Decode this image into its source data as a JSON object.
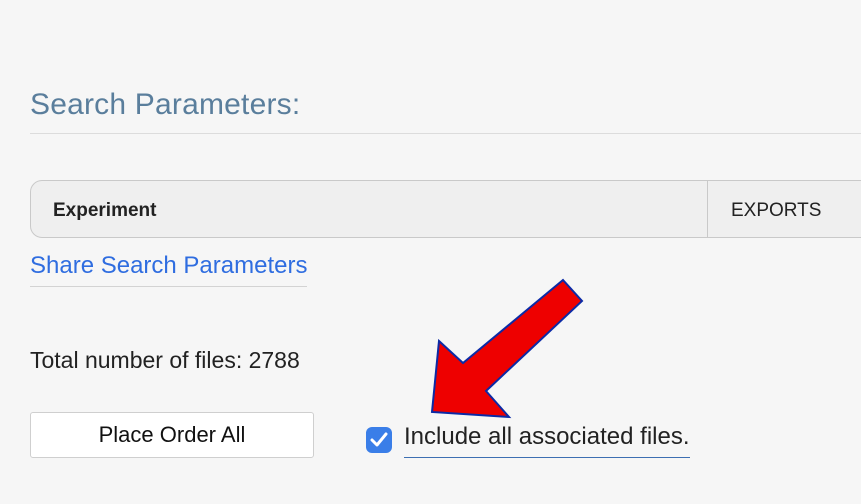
{
  "section": {
    "heading": "Search Parameters:"
  },
  "parameters": {
    "label": "Experiment",
    "exports_label": "EXPORTS"
  },
  "share": {
    "link_label": "Share Search Parameters"
  },
  "files": {
    "total_label": "Total number of files: 2788"
  },
  "actions": {
    "order_label": "Place Order All",
    "include_label": "Include all associated files.",
    "include_checked": true
  },
  "annotation": {
    "arrow_color": "#ee0000",
    "arrow_outline": "#0b2aa6"
  },
  "colors": {
    "heading": "#5a7e9c",
    "link": "#2f6de0",
    "checkbox": "#3a7ee8"
  }
}
